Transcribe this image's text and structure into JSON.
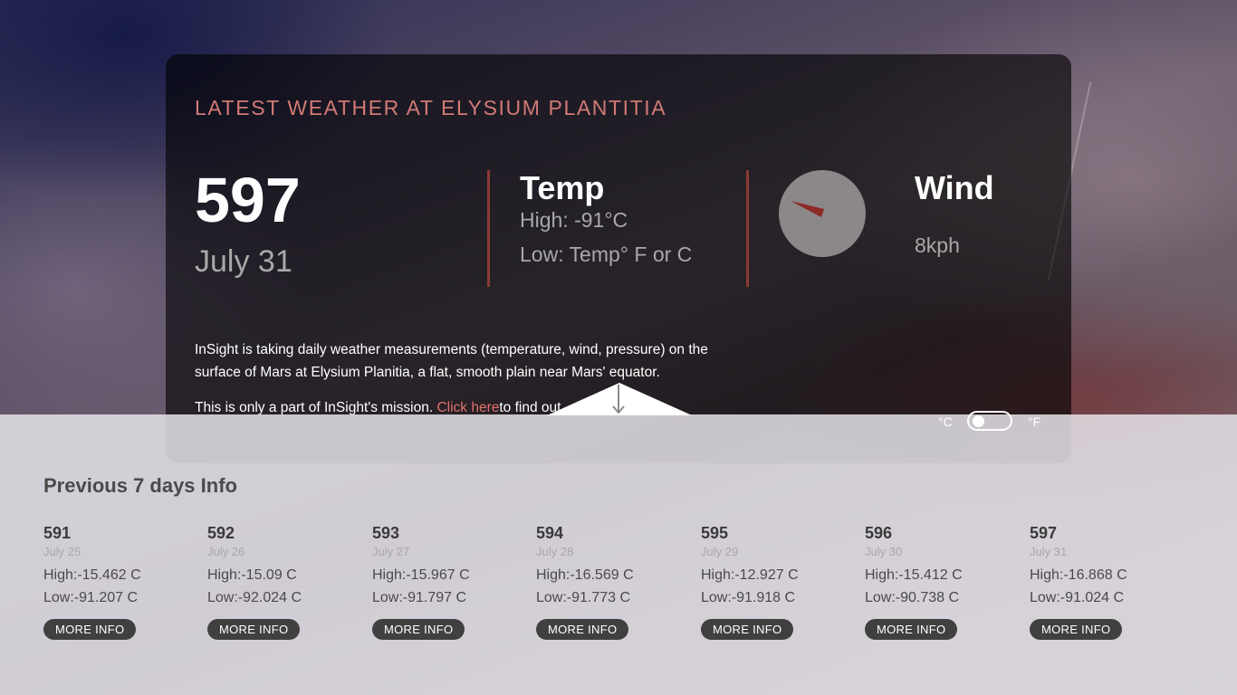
{
  "main": {
    "title": "LATEST WEATHER AT ELYSIUM PLANTITIA",
    "sol": "597",
    "date": "July 31",
    "temp": {
      "label": "Temp",
      "high": "High: -91°C",
      "low": "Low: Temp° F or C"
    },
    "wind": {
      "label": "Wind",
      "speed": "8kph"
    },
    "info": {
      "paragraph1": "InSight is taking daily weather measurements (temperature, wind, pressure) on the surface of Mars at Elysium Planitia, a flat, smooth plain near Mars' equator.",
      "paragraph2_prefix": "This is only a part of InSight's mission.",
      "link_label": "Click here",
      "paragraph2_suffix": "to find out"
    }
  },
  "units": {
    "celsius": "°C",
    "fahrenheit": "°F"
  },
  "previous": {
    "title": "Previous 7 days Info",
    "button_label": "MORE INFO",
    "days": [
      {
        "sol": "591",
        "date": "July 25",
        "high": "High:-15.462 C",
        "low": "Low:-91.207 C"
      },
      {
        "sol": "592",
        "date": "July 26",
        "high": "High:-15.09 C",
        "low": "Low:-92.024 C"
      },
      {
        "sol": "593",
        "date": "July 27",
        "high": "High:-15.967 C",
        "low": "Low:-91.797 C"
      },
      {
        "sol": "594",
        "date": "July 28",
        "high": "High:-16.569 C",
        "low": "Low:-91.773 C"
      },
      {
        "sol": "595",
        "date": "July 29",
        "high": "High:-12.927 C",
        "low": "Low:-91.918 C"
      },
      {
        "sol": "596",
        "date": "July 30",
        "high": "High:-15.412 C",
        "low": "Low:-90.738 C"
      },
      {
        "sol": "597",
        "date": "July 31",
        "high": "High:-16.868 C",
        "low": "Low:-91.024 C"
      }
    ]
  },
  "colors": {
    "accent": "#d27a76",
    "divider": "#8a3a34",
    "needle": "#8b2a26"
  },
  "icons": {
    "toggle": "arrow-down-icon",
    "wind_dial": "compass-icon"
  }
}
